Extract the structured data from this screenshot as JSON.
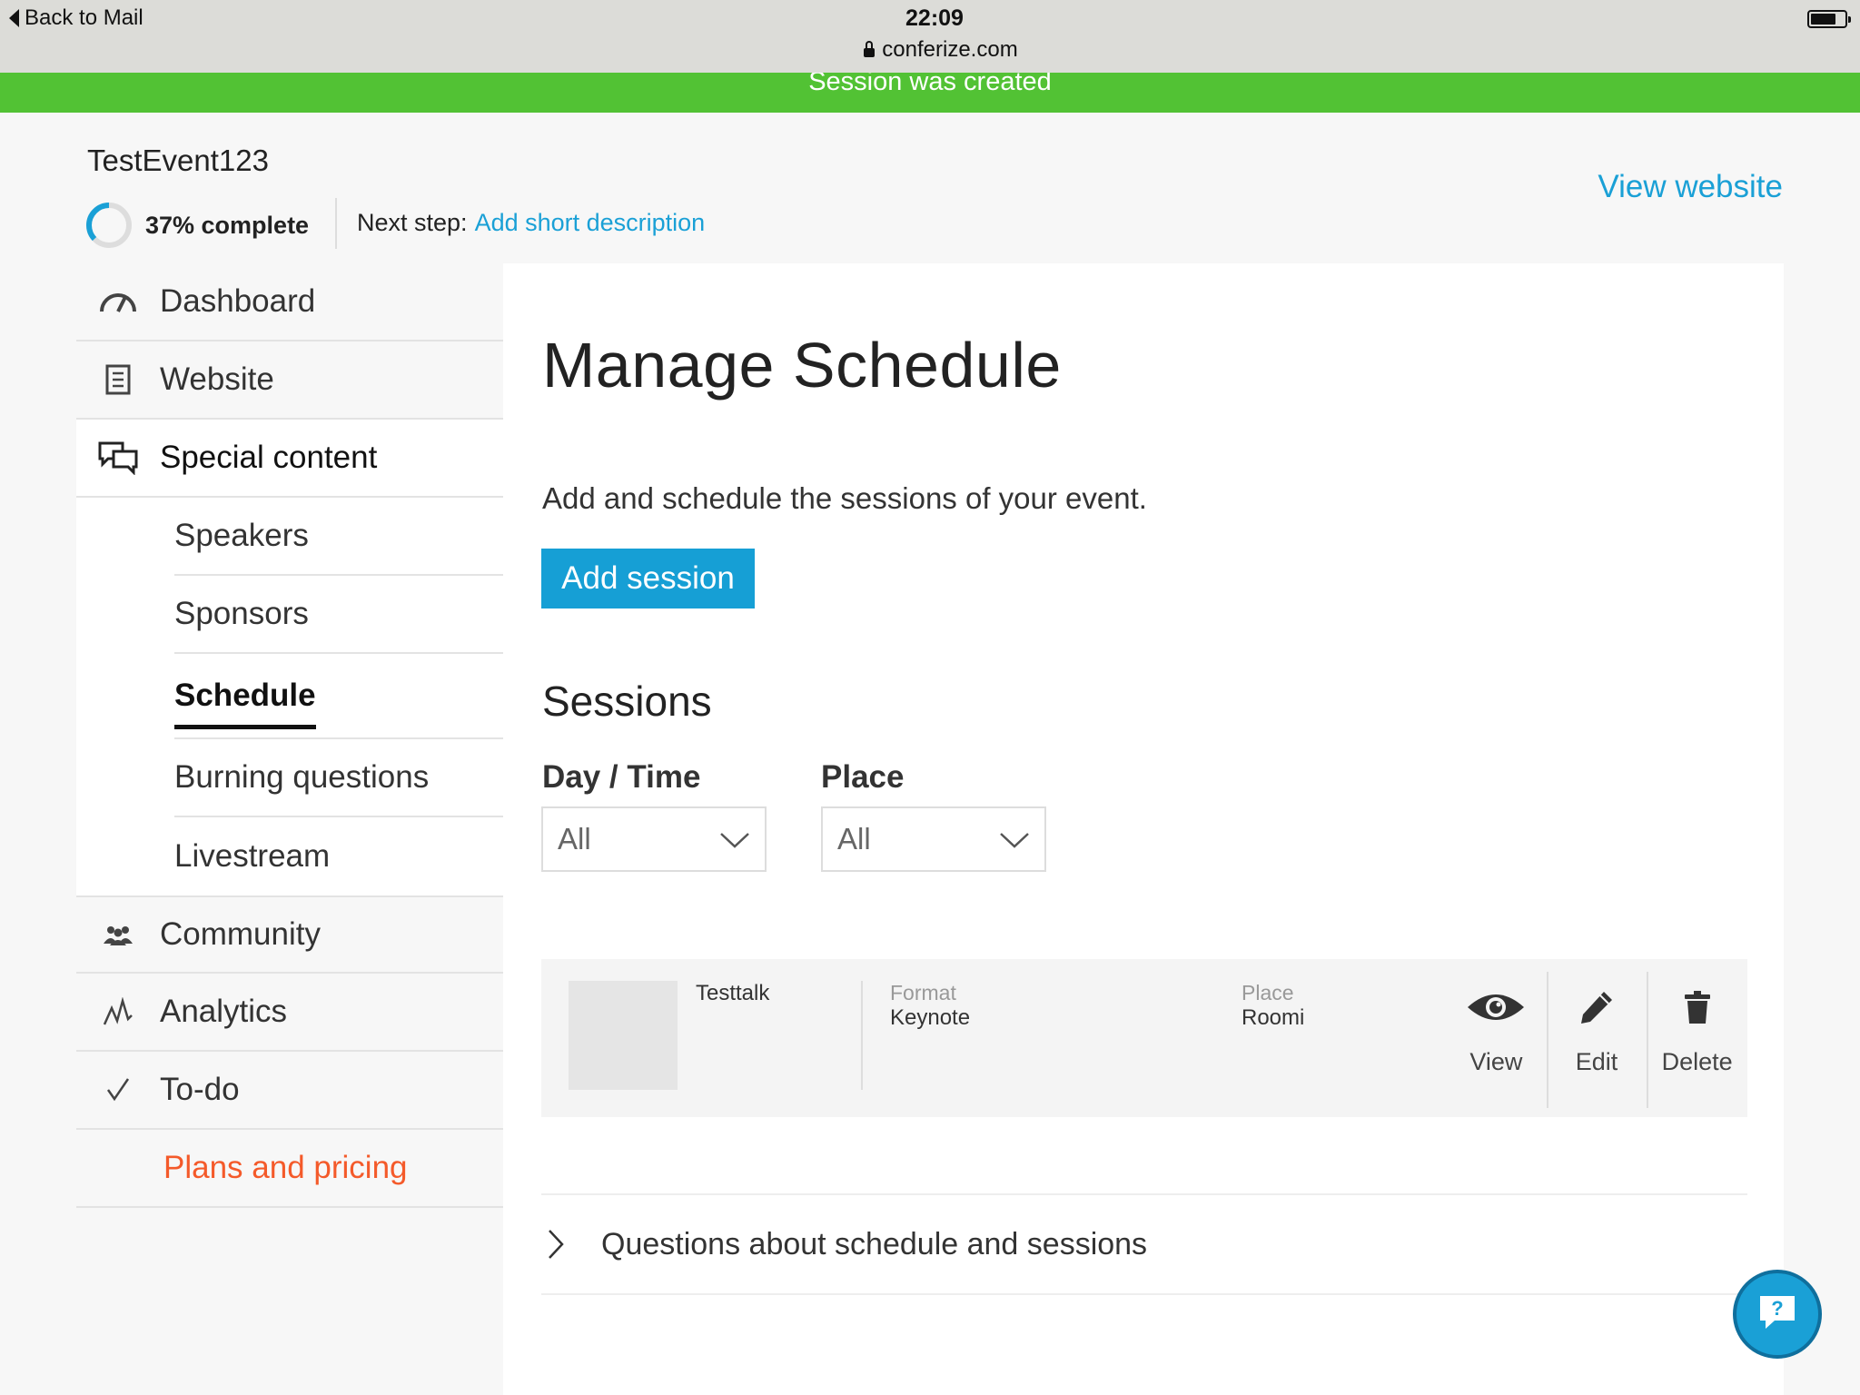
{
  "status_bar": {
    "back_label": "Back to Mail",
    "time": "22:09",
    "url": "conferize.com"
  },
  "banner": {
    "message": "Session was created",
    "color": "#52c234"
  },
  "header": {
    "event_title": "TestEvent123",
    "progress_label": "37% complete",
    "progress_fraction": 0.37,
    "next_step_label": "Next step:",
    "next_step_link": "Add short description",
    "view_website": "View website"
  },
  "sidebar": {
    "items": [
      {
        "label": "Dashboard",
        "icon": "dashboard-gauge-icon"
      },
      {
        "label": "Website",
        "icon": "document-icon"
      },
      {
        "label": "Special content",
        "icon": "speech-bubbles-icon"
      }
    ],
    "sub_items": [
      {
        "label": "Speakers"
      },
      {
        "label": "Sponsors"
      },
      {
        "label": "Schedule"
      },
      {
        "label": "Burning questions"
      },
      {
        "label": "Livestream"
      }
    ],
    "lower_items": [
      {
        "label": "Community",
        "icon": "people-icon"
      },
      {
        "label": "Analytics",
        "icon": "analytics-icon"
      },
      {
        "label": "To-do",
        "icon": "checkmark-icon"
      }
    ],
    "plans_label": "Plans and pricing"
  },
  "main": {
    "title": "Manage Schedule",
    "intro": "Add and schedule the sessions of your event.",
    "add_session": "Add session",
    "sessions_heading": "Sessions",
    "filters": {
      "day_time_label": "Day / Time",
      "day_time_value": "All",
      "place_label": "Place",
      "place_value": "All"
    },
    "sessions": [
      {
        "title": "Testtalk",
        "format_label": "Format",
        "format": "Keynote",
        "place_label": "Place",
        "place": "Roomi",
        "actions": {
          "view": "View",
          "edit": "Edit",
          "delete": "Delete"
        }
      }
    ],
    "faq": "Questions about schedule and sessions"
  },
  "colors": {
    "accent": "#1aa0d6",
    "plans": "#f45a2a",
    "success": "#52c234"
  }
}
